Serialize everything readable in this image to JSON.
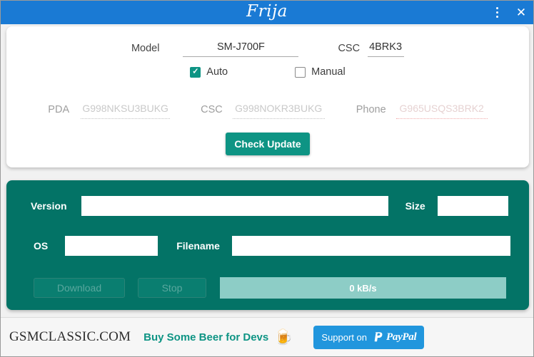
{
  "window": {
    "title": "Frija",
    "menu_icon": "kebab-menu-icon",
    "close_icon": "close-icon",
    "titlebar_color": "#1a7ad4"
  },
  "form": {
    "model_label": "Model",
    "model_value": "SM-J700F",
    "csc_label": "CSC",
    "csc_value": "4BRK3",
    "auto_label": "Auto",
    "auto_checked": true,
    "manual_label": "Manual",
    "manual_checked": false,
    "pda_label": "PDA",
    "pda_placeholder": "G998NKSU3BUKG",
    "pda_value": "",
    "csc2_label": "CSC",
    "csc2_placeholder": "G998NOKR3BUKG",
    "csc2_value": "",
    "phone_label": "Phone",
    "phone_placeholder": "G965USQS3BRK2",
    "phone_value": "",
    "check_update_label": "Check Update"
  },
  "download": {
    "version_label": "Version",
    "version_value": "",
    "size_label": "Size",
    "size_value": "",
    "os_label": "OS",
    "os_value": "",
    "filename_label": "Filename",
    "filename_value": "",
    "download_label": "Download",
    "stop_label": "Stop",
    "progress_text": "0 kB/s",
    "panel_color": "#037366",
    "progress_color": "#8dcdc6"
  },
  "footer": {
    "brand": "GSMCLASSIC.COM",
    "beer_link": "Buy Some Beer for Devs",
    "beer_icon": "beer-mug-icon",
    "beer_glyph": "🍺",
    "paypal_prefix": "Support on",
    "paypal_wordmark": "PayPal",
    "paypal_color": "#2196dd"
  }
}
